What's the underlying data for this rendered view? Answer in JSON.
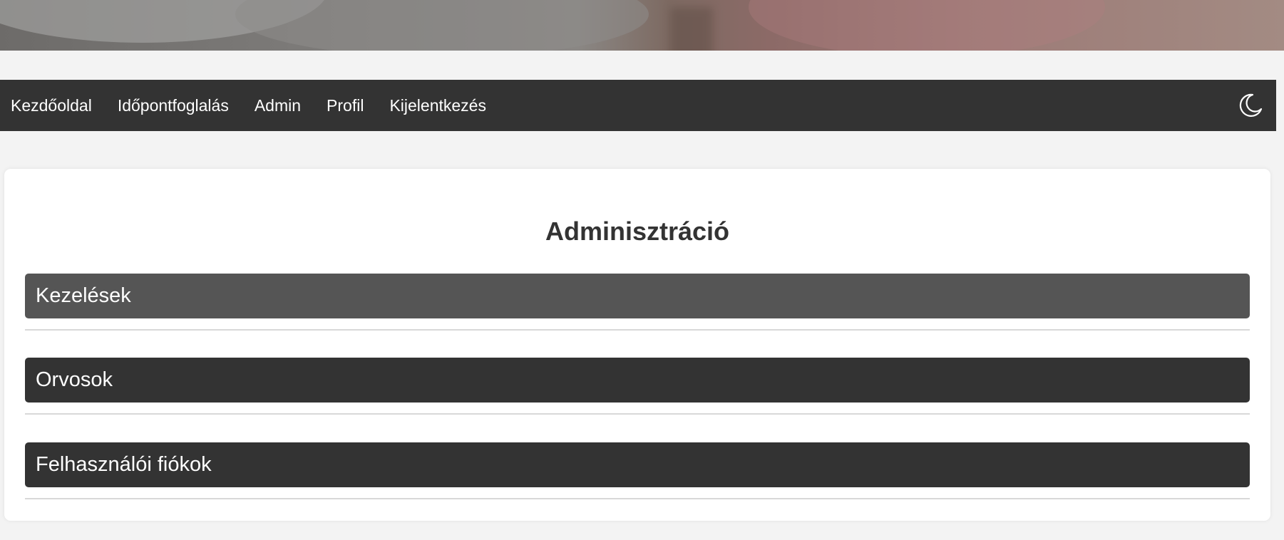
{
  "nav": {
    "items": [
      {
        "label": "Kezdőoldal"
      },
      {
        "label": "Időpontfoglalás"
      },
      {
        "label": "Admin"
      },
      {
        "label": "Profil"
      },
      {
        "label": "Kijelentkezés"
      }
    ],
    "theme_icon": "moon-icon"
  },
  "main": {
    "title": "Adminisztráció",
    "sections": [
      {
        "label": "Kezelések"
      },
      {
        "label": "Orvosok"
      },
      {
        "label": "Felhasználói fiókok"
      }
    ]
  },
  "colors": {
    "navbar": "#333333",
    "section_header": "#333333",
    "section_header_active": "#555555",
    "page_background": "#f3f3f3",
    "card_background": "#ffffff"
  }
}
